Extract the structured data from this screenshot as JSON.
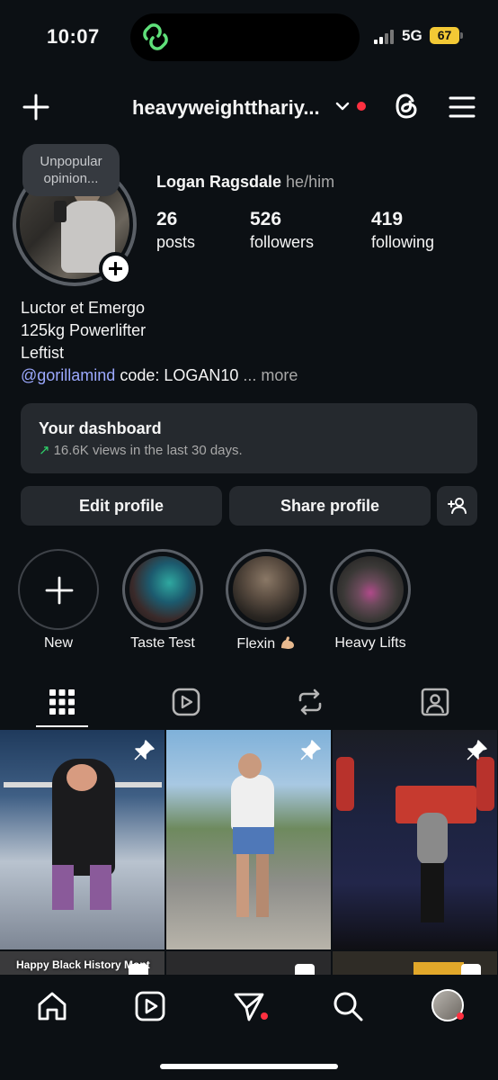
{
  "status_bar": {
    "time": "10:07",
    "network": "5G",
    "battery": "67"
  },
  "header": {
    "username": "heavyweightthariy...",
    "has_notification": true
  },
  "profile": {
    "note": "Unpopular opinion...",
    "name": "Logan Ragsdale",
    "pronouns": "he/him",
    "stats": [
      {
        "value": "26",
        "label": "posts"
      },
      {
        "value": "526",
        "label": "followers"
      },
      {
        "value": "419",
        "label": "following"
      }
    ],
    "bio": {
      "line1": "Luctor et Emergo",
      "line2": "125kg Powerlifter",
      "line3": "Leftist",
      "mention": "@gorillamind",
      "code_text": " code: LOGAN10",
      "more": "... more"
    }
  },
  "dashboard": {
    "title": "Your dashboard",
    "arrow": "↗",
    "subtitle": "16.6K views in the last 30 days."
  },
  "buttons": {
    "edit": "Edit profile",
    "share": "Share profile"
  },
  "highlights": [
    {
      "label": "New"
    },
    {
      "label": "Taste Test"
    },
    {
      "label": "Flexin"
    },
    {
      "label": "Heavy Lifts"
    }
  ],
  "posts": [
    {
      "pinned": true,
      "type": "reel"
    },
    {
      "pinned": true,
      "type": "reel"
    },
    {
      "pinned": true,
      "type": "reel"
    }
  ],
  "second_row_caption": "Happy Black History Mont",
  "colors": {
    "background": "#0c1014",
    "surface": "#25292e",
    "mention": "#9ca9ff",
    "notification": "#ff3040",
    "trend": "#2fd36a"
  }
}
